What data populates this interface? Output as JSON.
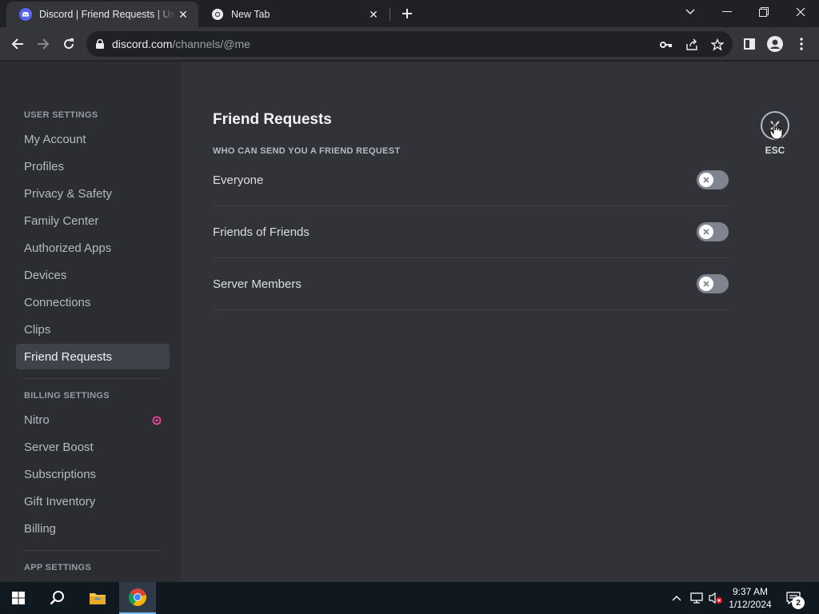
{
  "browser": {
    "tabs": [
      {
        "title": "Discord | Friend Requests | User Settings",
        "active": true,
        "icon": "discord-icon"
      },
      {
        "title": "New Tab",
        "active": false,
        "icon": "chrome-icon"
      }
    ],
    "url_host": "discord.com",
    "url_path": "/channels/@me"
  },
  "sidebar": {
    "user_settings_header": "USER SETTINGS",
    "user_items": [
      "My Account",
      "Profiles",
      "Privacy & Safety",
      "Family Center",
      "Authorized Apps",
      "Devices",
      "Connections",
      "Clips",
      "Friend Requests"
    ],
    "selected": "Friend Requests",
    "billing_settings_header": "BILLING SETTINGS",
    "billing_items": [
      "Nitro",
      "Server Boost",
      "Subscriptions",
      "Gift Inventory",
      "Billing"
    ],
    "app_settings_header": "APP SETTINGS"
  },
  "main": {
    "title": "Friend Requests",
    "section_label": "WHO CAN SEND YOU A FRIEND REQUEST",
    "options": [
      {
        "label": "Everyone",
        "enabled": false
      },
      {
        "label": "Friends of Friends",
        "enabled": false
      },
      {
        "label": "Server Members",
        "enabled": false
      }
    ],
    "close_label": "ESC"
  },
  "taskbar": {
    "time": "9:37 AM",
    "date": "1/12/2024",
    "notification_count": "2"
  },
  "colors": {
    "discord_blurple": "#5865f2",
    "nitro_pink": "#eb459e",
    "toggle_off": "#80848e"
  }
}
